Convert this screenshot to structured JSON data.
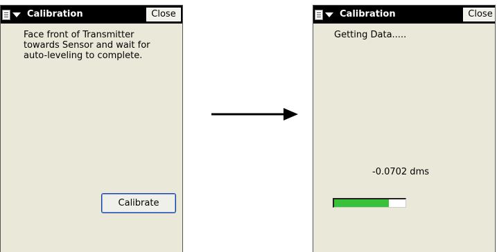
{
  "left_screen": {
    "title": "Calibration",
    "close_label": "Close",
    "instructions": "Face front of Transmitter\ntowards Sensor and wait for\nauto-leveling to complete.",
    "calibrate_label": "Calibrate",
    "icons": [
      "start-menu-icon",
      "chevron-down-icon"
    ]
  },
  "right_screen": {
    "title": "Calibration",
    "close_label": "Close",
    "status": "Getting Data.....",
    "angle_readout": "-0.0702 dms",
    "progress_fraction": 0.77,
    "icons": [
      "start-menu-icon",
      "chevron-down-icon"
    ]
  },
  "arrow": {
    "icon": "arrow-right-icon"
  },
  "colors": {
    "screen_bg": "#eae8d8",
    "titlebar_bg": "#000000",
    "progress_fill": "#38c23a",
    "button_border": "#1b3e9c"
  }
}
